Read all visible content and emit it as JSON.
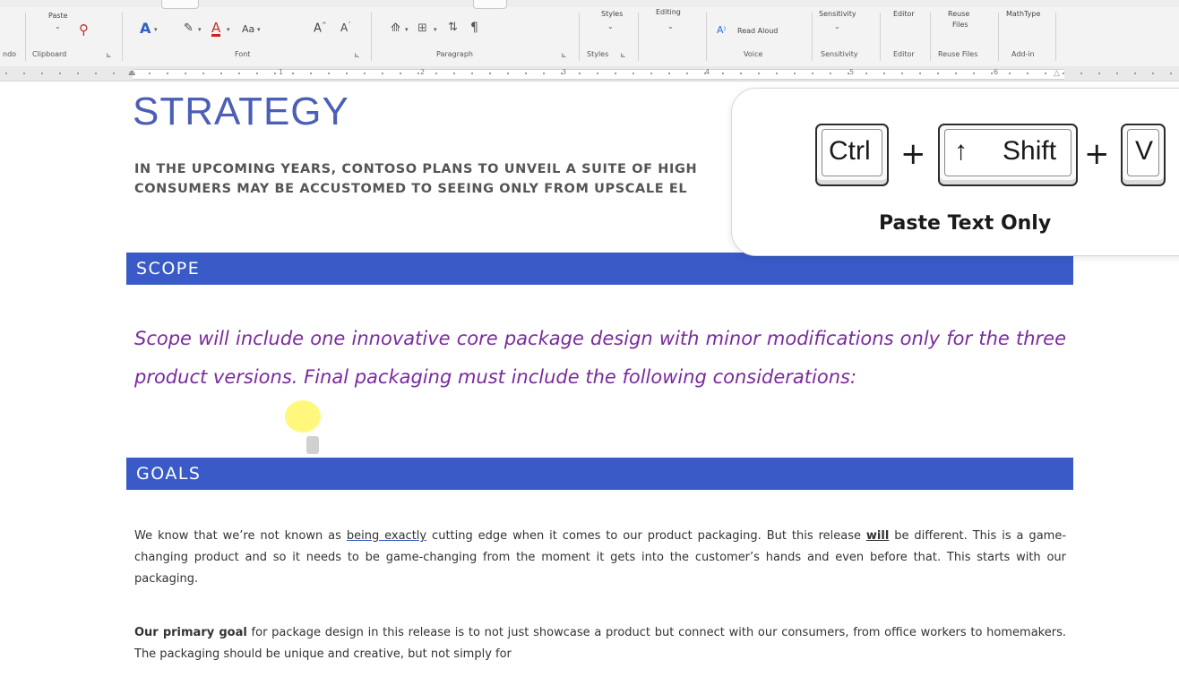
{
  "ribbon": {
    "left_cut_label": "ndo",
    "clipboard": {
      "paste_label": "Paste",
      "group_label": "Clipboard"
    },
    "font": {
      "change_case_label": "Aa",
      "group_label": "Font"
    },
    "paragraph": {
      "group_label": "Paragraph"
    },
    "styles": {
      "button_label": "Styles",
      "group_label": "Styles"
    },
    "editing": {
      "button_label": "Editing"
    },
    "voice": {
      "read_aloud_label": "Read Aloud",
      "group_label": "Voice"
    },
    "sensitivity": {
      "button_label": "Sensitivity",
      "group_label": "Sensitivity"
    },
    "editor": {
      "button_label": "Editor",
      "group_label": "Editor"
    },
    "reuse_files": {
      "button_line1": "Reuse",
      "button_line2": "Files",
      "group_label": "Reuse Files"
    },
    "addin": {
      "button_label": "MathType",
      "group_label": "Add-in"
    }
  },
  "ruler": {
    "numbers": [
      "1",
      "2",
      "3",
      "4",
      "5",
      "6"
    ]
  },
  "document": {
    "title": "STRATEGY",
    "intro_line1": "IN THE UPCOMING YEARS, CONTOSO PLANS TO UNVEIL A SUITE OF HIGH",
    "intro_line2": "CONSUMERS MAY BE ACCUSTOMED TO SEEING ONLY FROM UPSCALE EL",
    "scope_heading": "SCOPE",
    "scope_text": "Scope will include one innovative core package design with minor modifications only for the three product versions. Final packaging must include the following considerations:",
    "goals_heading": "GOALS",
    "goals_p1_a": "We know that we’re not known as ",
    "goals_p1_underlined": "being exactly",
    "goals_p1_b": " cutting edge when it comes to our product packaging. But this release ",
    "goals_p1_bold": "will",
    "goals_p1_c": " be different. This is a game-changing product and so it needs to be game-changing from the moment it gets into the customer’s hands and even before that. This starts with our packaging.",
    "goals_p2_bold": "Our primary goal",
    "goals_p2_rest": " for package design in this release is to not just showcase a product but connect with our consumers, from office workers to homemakers. The packaging should be unique and creative, but not simply for"
  },
  "overlay": {
    "key1": "Ctrl",
    "plus1": "+",
    "key2_arrow": "↑",
    "key2": "Shift",
    "plus2": "+",
    "key3": "V",
    "caption": "Paste Text Only"
  },
  "colors": {
    "heading_band": "#3a5bc7",
    "title": "#4a5fb5",
    "scope_text": "#7a2a9e"
  }
}
